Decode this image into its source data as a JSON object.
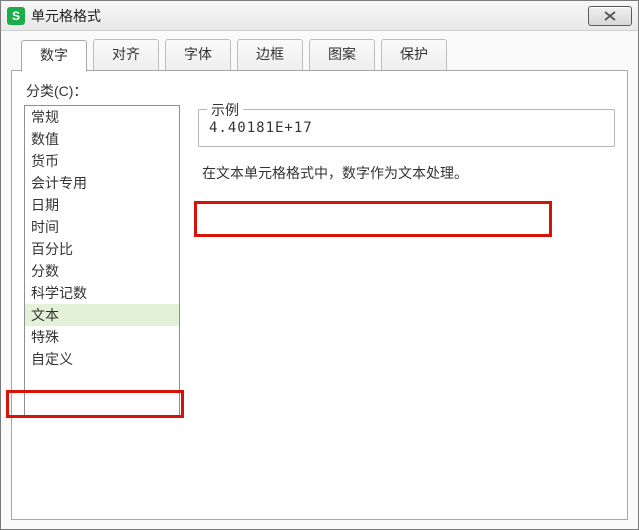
{
  "window": {
    "title": "单元格格式",
    "icon_letter": "S"
  },
  "tabs": [
    {
      "label": "数字",
      "active": true
    },
    {
      "label": "对齐",
      "active": false
    },
    {
      "label": "字体",
      "active": false
    },
    {
      "label": "边框",
      "active": false
    },
    {
      "label": "图案",
      "active": false
    },
    {
      "label": "保护",
      "active": false
    }
  ],
  "category_label": "分类(C)：",
  "categories": [
    {
      "label": "常规",
      "selected": false
    },
    {
      "label": "数值",
      "selected": false
    },
    {
      "label": "货币",
      "selected": false
    },
    {
      "label": "会计专用",
      "selected": false
    },
    {
      "label": "日期",
      "selected": false
    },
    {
      "label": "时间",
      "selected": false
    },
    {
      "label": "百分比",
      "selected": false
    },
    {
      "label": "分数",
      "selected": false
    },
    {
      "label": "科学记数",
      "selected": false
    },
    {
      "label": "文本",
      "selected": true
    },
    {
      "label": "特殊",
      "selected": false
    },
    {
      "label": "自定义",
      "selected": false
    }
  ],
  "sample": {
    "legend": "示例",
    "value": "4.40181E+17"
  },
  "description": "在文本单元格格式中，数字作为文本处理。",
  "highlight_color": "#d6120a"
}
